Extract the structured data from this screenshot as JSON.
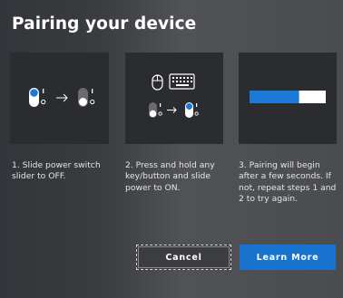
{
  "dialog": {
    "title": "Pairing your device"
  },
  "steps": [
    {
      "text": "1. Slide power switch slider to OFF."
    },
    {
      "text": "2. Press and hold any key/button and slide power to ON."
    },
    {
      "text": "3. Pairing will begin after a few seconds. If not, repeat steps 1 and 2 to try again."
    }
  ],
  "buttons": {
    "cancel_label": "Cancel",
    "learn_more_label": "Learn More"
  },
  "pairing_progress": 0.65,
  "colors": {
    "accent": "#1874cf",
    "progress_fill": "#1c7ad6",
    "progress_track": "#ffffff",
    "panel_bg": "#2b2c2f"
  },
  "icons": {
    "switch_on": "toggle-on-icon",
    "switch_off": "toggle-off-icon",
    "arrow": "arrow-right-icon",
    "mouse": "mouse-icon",
    "keyboard": "keyboard-icon"
  }
}
